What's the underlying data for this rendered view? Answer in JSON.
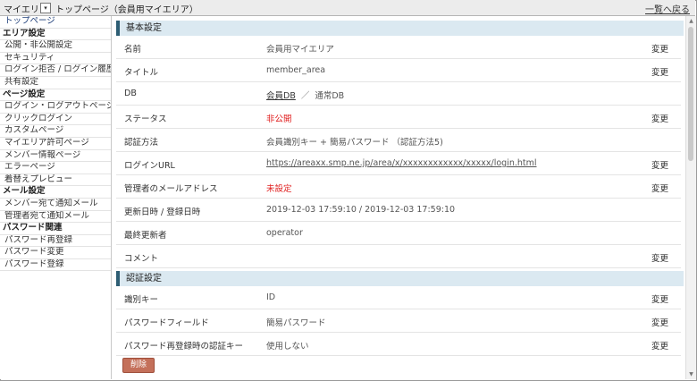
{
  "topbar": {
    "app_name": "マイエリア",
    "dropdown_glyph": "▾",
    "breadcrumb": "トップページ（会員用マイエリア）",
    "back_link": "一覧へ戻る"
  },
  "sidebar": {
    "top_item": "トップページ",
    "sections": [
      {
        "heading": "エリア設定",
        "items": [
          "公開・非公開設定",
          "セキュリティ",
          "ログイン拒否 / ログイン履歴",
          "共有設定"
        ]
      },
      {
        "heading": "ページ設定",
        "items": [
          "ログイン・ログアウトページ",
          "クリックログイン",
          "カスタムページ",
          "マイエリア許可ページ",
          "メンバー情報ページ",
          "エラーページ",
          "着替えプレビュー"
        ]
      },
      {
        "heading": "メール設定",
        "items": [
          "メンバー宛て通知メール",
          "管理者宛て通知メール"
        ]
      },
      {
        "heading": "パスワード関連",
        "items": [
          "パスワード再登録",
          "パスワード変更",
          "パスワード登録"
        ]
      }
    ]
  },
  "basic": {
    "heading": "基本設定",
    "change_label": "変更",
    "rows": {
      "name": {
        "label": "名前",
        "value": "会員用マイエリア"
      },
      "title": {
        "label": "タイトル",
        "value": "member_area"
      },
      "db": {
        "label": "DB",
        "option_member": "会員DB",
        "separator": "／",
        "option_normal": "通常DB"
      },
      "status": {
        "label": "ステータス",
        "value": "非公開"
      },
      "auth": {
        "label": "認証方法",
        "value": "会員識別キー + 簡易パスワード （認証方法5)"
      },
      "login_url": {
        "label": "ログインURL",
        "value": "https://areaxx.smp.ne.jp/area/x/xxxxxxxxxxxx/xxxxx/login.html"
      },
      "admin_mail": {
        "label": "管理者のメールアドレス",
        "value": "未設定"
      },
      "updated": {
        "label": "更新日時 / 登録日時",
        "value": "2019-12-03 17:59:10 / 2019-12-03 17:59:10"
      },
      "last_updater": {
        "label": "最終更新者",
        "value": "operator"
      },
      "comment": {
        "label": "コメント",
        "value": ""
      }
    }
  },
  "auth_settings": {
    "heading": "認証設定",
    "rows": {
      "id_key": {
        "label": "識別キー",
        "value": "ID"
      },
      "pw_field": {
        "label": "パスワードフィールド",
        "value": "簡易パスワード"
      },
      "reregister_key": {
        "label": "パスワード再登録時の認証キー",
        "value": "使用しない"
      }
    }
  },
  "delete_button": "削除",
  "colors": {
    "section_bar": "#dbe9f1",
    "section_accent": "#2e5e74",
    "alert_red": "#e02020",
    "delete_button": "#c4705a"
  }
}
